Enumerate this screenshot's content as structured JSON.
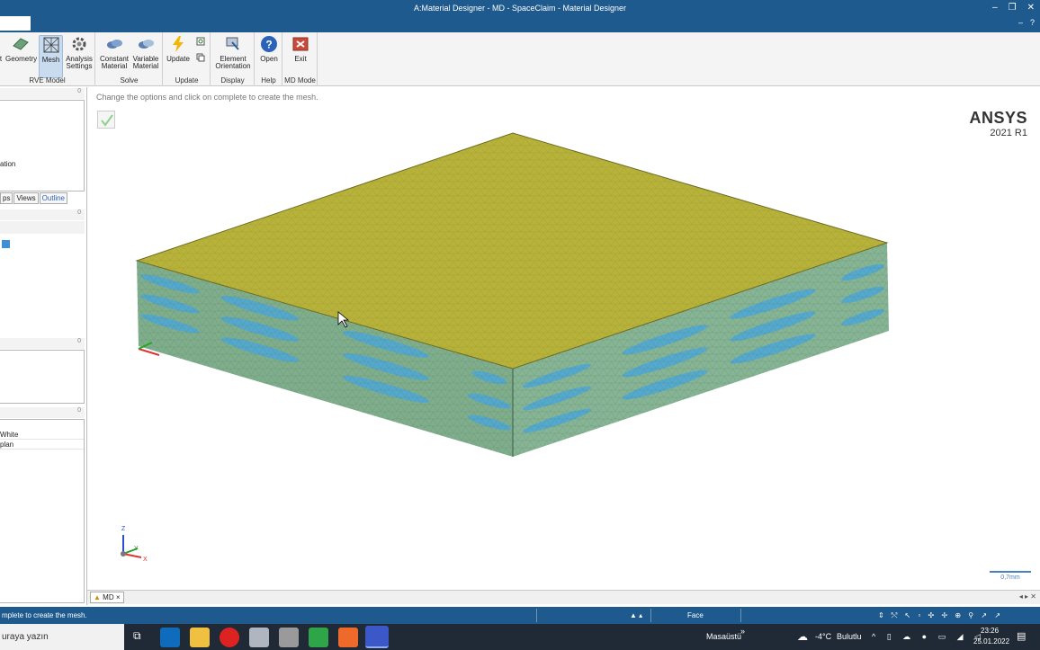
{
  "window": {
    "title": "A:Material Designer - MD - SpaceClaim - Material Designer",
    "controls": [
      "–",
      "❐",
      "✕"
    ]
  },
  "ribbon": {
    "right_controls": [
      "–",
      "?"
    ],
    "groups": [
      {
        "label": "RVE Model",
        "buttons": [
          "t",
          "Geometry",
          "Mesh",
          "Analysis Settings"
        ]
      },
      {
        "label": "Solve",
        "buttons": [
          "Constant Material",
          "Variable Material"
        ]
      },
      {
        "label": "Update",
        "buttons": [
          "Update"
        ]
      },
      {
        "label": "Display",
        "buttons": [
          "Element Orientation"
        ]
      },
      {
        "label": "Help",
        "buttons": [
          "Open"
        ]
      },
      {
        "label": "MD Mode",
        "buttons": [
          "Exit"
        ]
      }
    ]
  },
  "left_panel": {
    "pin": "0",
    "item_text": "ation",
    "tabs": [
      "ps",
      "Views",
      "Outline"
    ],
    "list_items": [
      "White",
      "plan"
    ]
  },
  "viewport": {
    "hint": "Change the options and click on complete to create the mesh.",
    "brand": "ANSYS",
    "version": "2021 R1",
    "scale_label": "0,7mm",
    "axis_z": "Z",
    "axis_y": "Y",
    "axis_x": "X"
  },
  "doc_tabs": {
    "tab_label": "MD",
    "close": "×",
    "nav": "◂ ▸ ✕"
  },
  "status": {
    "message": "mplete to create the mesh.",
    "selection_mode": "Face"
  },
  "taskbar": {
    "search_placeholder": "uraya yazın",
    "desktop_label": "Masaüstü",
    "weather_temp": "-4°C",
    "weather_text": "Bulutlu",
    "time": "23:26",
    "date": "25.01.2022"
  },
  "colors": {
    "titlebar": "#1e5a8e",
    "top_face": "#b7b23a",
    "side_face": "#7fae8d",
    "fiber": "#4ea8d6"
  }
}
